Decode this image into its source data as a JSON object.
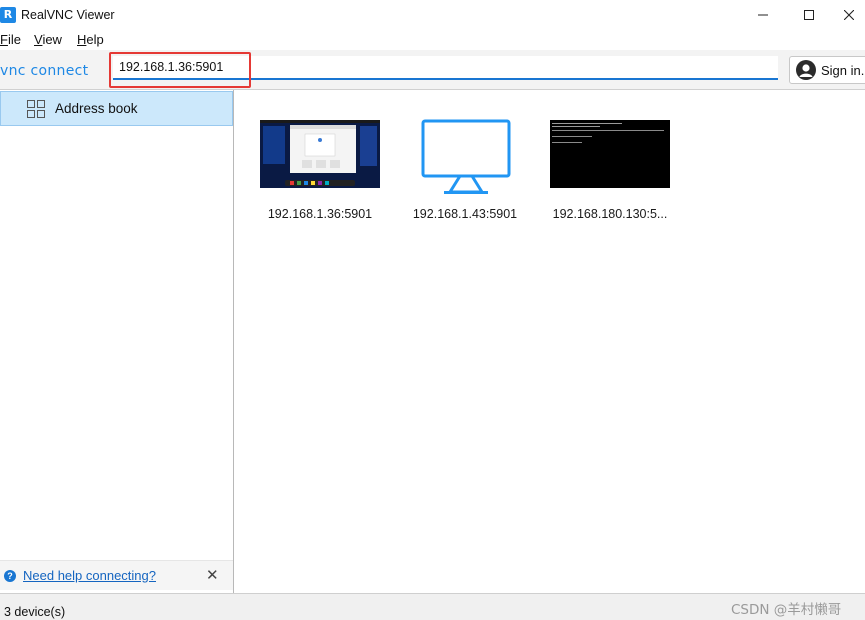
{
  "window": {
    "title": "RealVNC Viewer",
    "app_icon_glyph": "R",
    "controls": [
      "minimize-icon",
      "maximize-icon",
      "close-icon"
    ]
  },
  "menu": {
    "file": {
      "mnemonic": "F",
      "rest": "ile"
    },
    "view": {
      "mnemonic": "V",
      "rest": "iew"
    },
    "help": {
      "mnemonic": "H",
      "rest": "elp"
    }
  },
  "toolbar": {
    "brand": "RVNC CONNECT",
    "address_value": "192.168.1.36:5901",
    "signin_label": "Sign in..",
    "signin_icon": "user-avatar-icon"
  },
  "sidebar": {
    "items": [
      {
        "label": "Address book",
        "icon": "grid-icon",
        "selected": true
      }
    ],
    "help_link": "Need help connecting?",
    "help_icon": "question-icon",
    "close_glyph": "✕"
  },
  "devices": [
    {
      "label": "192.168.1.36:5901",
      "thumbnail": "desktop-screenshot"
    },
    {
      "label": "192.168.1.43:5901",
      "thumbnail": "monitor-icon"
    },
    {
      "label": "192.168.180.130:5...",
      "thumbnail": "terminal-screenshot"
    }
  ],
  "status": {
    "device_count": "3 device(s)",
    "watermark": "CSDN @羊村懒哥"
  },
  "colors": {
    "accent": "#1976d2",
    "selection": "#cce8fb",
    "highlight_box": "#e53935"
  }
}
